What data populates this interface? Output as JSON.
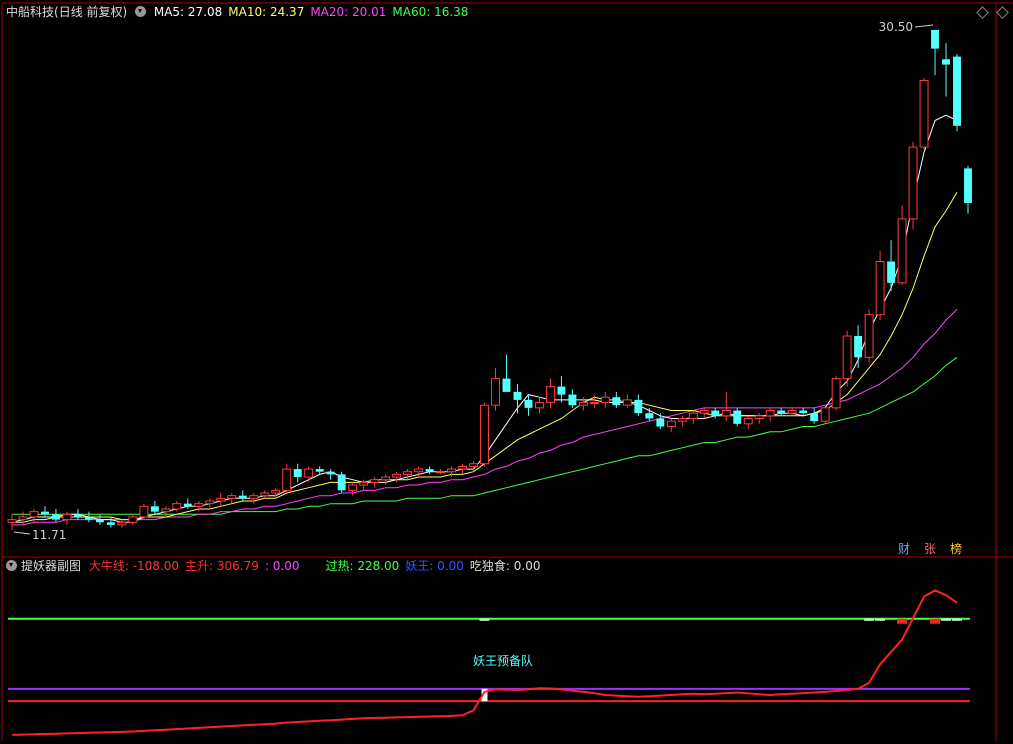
{
  "main_panel": {
    "stock_name": "中船科技",
    "period": "(日线 前复权)",
    "ma": [
      {
        "label": "MA5: 27.08",
        "color": "#ffffff"
      },
      {
        "label": "MA10: 24.37",
        "color": "#ffff66"
      },
      {
        "label": "MA20: 20.01",
        "color": "#ff44ff"
      },
      {
        "label": "MA60: 16.38",
        "color": "#44ff44"
      }
    ],
    "high_label": "30.50",
    "low_label": "11.71",
    "side_tags": [
      {
        "label": "财",
        "color": "#66aaff"
      },
      {
        "label": "张",
        "color": "#ff6666"
      },
      {
        "label": "榜",
        "color": "#ffcc33"
      }
    ]
  },
  "sub_panel": {
    "title": "提妖器副图",
    "items": [
      {
        "label": "大牛线: -108.00",
        "color": "#ff3333"
      },
      {
        "label": "主升: 306.79",
        "color": "#ff3333"
      },
      {
        "label": ": 0.00",
        "color": "#ff44ff"
      },
      {
        "label": "过热: 228.00",
        "color": "#44ff44"
      },
      {
        "label": "妖王: 0.00",
        "color": "#3355ff"
      },
      {
        "label": "吃独食: 0.00",
        "color": "#dddddd"
      }
    ],
    "annotation": "妖王预备队"
  },
  "colors": {
    "up": "#ff3b3b",
    "down": "#54ffff",
    "ma5": "#ffffff",
    "ma10": "#ffff66",
    "ma20": "#ff44ff",
    "ma60": "#44ff44",
    "frame": "#b00000"
  },
  "chart_data": {
    "type": "candlestick",
    "price_range": [
      11.71,
      30.5
    ],
    "candles": [
      {
        "o": 12.0,
        "h": 12.3,
        "l": 11.71,
        "c": 12.1
      },
      {
        "o": 12.1,
        "h": 12.4,
        "l": 11.9,
        "c": 12.2
      },
      {
        "o": 12.2,
        "h": 12.5,
        "l": 12.0,
        "c": 12.4
      },
      {
        "o": 12.4,
        "h": 12.6,
        "l": 12.2,
        "c": 12.3
      },
      {
        "o": 12.3,
        "h": 12.5,
        "l": 12.0,
        "c": 12.1
      },
      {
        "o": 12.1,
        "h": 12.4,
        "l": 11.9,
        "c": 12.3
      },
      {
        "o": 12.3,
        "h": 12.5,
        "l": 12.1,
        "c": 12.2
      },
      {
        "o": 12.2,
        "h": 12.4,
        "l": 12.0,
        "c": 12.1
      },
      {
        "o": 12.1,
        "h": 12.3,
        "l": 11.9,
        "c": 12.0
      },
      {
        "o": 12.0,
        "h": 12.2,
        "l": 11.8,
        "c": 11.9
      },
      {
        "o": 11.9,
        "h": 12.1,
        "l": 11.8,
        "c": 12.0
      },
      {
        "o": 12.0,
        "h": 12.3,
        "l": 11.9,
        "c": 12.2
      },
      {
        "o": 12.2,
        "h": 12.7,
        "l": 12.1,
        "c": 12.6
      },
      {
        "o": 12.6,
        "h": 12.8,
        "l": 12.3,
        "c": 12.4
      },
      {
        "o": 12.4,
        "h": 12.6,
        "l": 12.2,
        "c": 12.5
      },
      {
        "o": 12.5,
        "h": 12.8,
        "l": 12.4,
        "c": 12.7
      },
      {
        "o": 12.7,
        "h": 12.9,
        "l": 12.5,
        "c": 12.6
      },
      {
        "o": 12.6,
        "h": 12.8,
        "l": 12.4,
        "c": 12.7
      },
      {
        "o": 12.7,
        "h": 12.9,
        "l": 12.5,
        "c": 12.8
      },
      {
        "o": 12.8,
        "h": 13.1,
        "l": 12.6,
        "c": 12.9
      },
      {
        "o": 12.9,
        "h": 13.1,
        "l": 12.7,
        "c": 13.0
      },
      {
        "o": 13.0,
        "h": 13.2,
        "l": 12.8,
        "c": 12.9
      },
      {
        "o": 12.9,
        "h": 13.1,
        "l": 12.7,
        "c": 13.0
      },
      {
        "o": 13.0,
        "h": 13.2,
        "l": 12.9,
        "c": 13.1
      },
      {
        "o": 13.1,
        "h": 13.3,
        "l": 12.9,
        "c": 13.2
      },
      {
        "o": 13.2,
        "h": 14.2,
        "l": 13.1,
        "c": 14.0
      },
      {
        "o": 14.0,
        "h": 14.2,
        "l": 13.5,
        "c": 13.7
      },
      {
        "o": 13.7,
        "h": 14.1,
        "l": 13.5,
        "c": 14.0
      },
      {
        "o": 14.0,
        "h": 14.1,
        "l": 13.8,
        "c": 13.9
      },
      {
        "o": 13.9,
        "h": 14.0,
        "l": 13.6,
        "c": 13.8
      },
      {
        "o": 13.8,
        "h": 13.9,
        "l": 13.1,
        "c": 13.2
      },
      {
        "o": 13.2,
        "h": 13.5,
        "l": 13.0,
        "c": 13.4
      },
      {
        "o": 13.4,
        "h": 13.6,
        "l": 13.2,
        "c": 13.5
      },
      {
        "o": 13.5,
        "h": 13.7,
        "l": 13.3,
        "c": 13.6
      },
      {
        "o": 13.6,
        "h": 13.8,
        "l": 13.4,
        "c": 13.7
      },
      {
        "o": 13.7,
        "h": 13.9,
        "l": 13.5,
        "c": 13.8
      },
      {
        "o": 13.8,
        "h": 14.0,
        "l": 13.6,
        "c": 13.9
      },
      {
        "o": 13.9,
        "h": 14.1,
        "l": 13.7,
        "c": 14.0
      },
      {
        "o": 14.0,
        "h": 14.1,
        "l": 13.8,
        "c": 13.9
      },
      {
        "o": 13.9,
        "h": 14.0,
        "l": 13.8,
        "c": 13.9
      },
      {
        "o": 13.9,
        "h": 14.1,
        "l": 13.7,
        "c": 14.0
      },
      {
        "o": 14.0,
        "h": 14.2,
        "l": 13.8,
        "c": 14.1
      },
      {
        "o": 14.1,
        "h": 14.3,
        "l": 13.9,
        "c": 14.2
      },
      {
        "o": 14.2,
        "h": 16.5,
        "l": 14.1,
        "c": 16.4
      },
      {
        "o": 16.4,
        "h": 17.8,
        "l": 16.2,
        "c": 17.4
      },
      {
        "o": 17.4,
        "h": 18.3,
        "l": 16.9,
        "c": 16.9
      },
      {
        "o": 16.9,
        "h": 17.2,
        "l": 16.1,
        "c": 16.6
      },
      {
        "o": 16.6,
        "h": 16.8,
        "l": 16.0,
        "c": 16.3
      },
      {
        "o": 16.3,
        "h": 16.7,
        "l": 16.1,
        "c": 16.5
      },
      {
        "o": 16.5,
        "h": 17.4,
        "l": 16.3,
        "c": 17.1
      },
      {
        "o": 17.1,
        "h": 17.5,
        "l": 16.5,
        "c": 16.8
      },
      {
        "o": 16.8,
        "h": 17.0,
        "l": 16.3,
        "c": 16.4
      },
      {
        "o": 16.4,
        "h": 16.7,
        "l": 16.2,
        "c": 16.5
      },
      {
        "o": 16.5,
        "h": 16.8,
        "l": 16.3,
        "c": 16.5
      },
      {
        "o": 16.5,
        "h": 16.9,
        "l": 16.3,
        "c": 16.7
      },
      {
        "o": 16.7,
        "h": 16.9,
        "l": 16.3,
        "c": 16.4
      },
      {
        "o": 16.4,
        "h": 16.8,
        "l": 16.3,
        "c": 16.6
      },
      {
        "o": 16.6,
        "h": 16.8,
        "l": 16.0,
        "c": 16.1
      },
      {
        "o": 16.1,
        "h": 16.3,
        "l": 15.8,
        "c": 15.9
      },
      {
        "o": 15.9,
        "h": 16.1,
        "l": 15.5,
        "c": 15.6
      },
      {
        "o": 15.6,
        "h": 15.9,
        "l": 15.4,
        "c": 15.8
      },
      {
        "o": 15.8,
        "h": 16.0,
        "l": 15.6,
        "c": 15.9
      },
      {
        "o": 15.9,
        "h": 16.2,
        "l": 15.7,
        "c": 16.1
      },
      {
        "o": 16.1,
        "h": 16.3,
        "l": 15.9,
        "c": 16.2
      },
      {
        "o": 16.2,
        "h": 16.3,
        "l": 15.9,
        "c": 16.0
      },
      {
        "o": 16.0,
        "h": 16.9,
        "l": 15.8,
        "c": 16.2
      },
      {
        "o": 16.2,
        "h": 16.3,
        "l": 15.6,
        "c": 15.7
      },
      {
        "o": 15.7,
        "h": 16.0,
        "l": 15.5,
        "c": 15.9
      },
      {
        "o": 15.9,
        "h": 16.1,
        "l": 15.7,
        "c": 16.0
      },
      {
        "o": 16.0,
        "h": 16.3,
        "l": 15.8,
        "c": 16.2
      },
      {
        "o": 16.2,
        "h": 16.3,
        "l": 16.0,
        "c": 16.1
      },
      {
        "o": 16.1,
        "h": 16.3,
        "l": 16.0,
        "c": 16.2
      },
      {
        "o": 16.2,
        "h": 16.3,
        "l": 16.0,
        "c": 16.1
      },
      {
        "o": 16.1,
        "h": 16.3,
        "l": 15.7,
        "c": 15.8
      },
      {
        "o": 15.8,
        "h": 16.4,
        "l": 15.7,
        "c": 16.3
      },
      {
        "o": 16.3,
        "h": 17.5,
        "l": 16.2,
        "c": 17.4
      },
      {
        "o": 17.4,
        "h": 19.2,
        "l": 17.1,
        "c": 19.0
      },
      {
        "o": 19.0,
        "h": 19.4,
        "l": 17.8,
        "c": 18.2
      },
      {
        "o": 18.2,
        "h": 20.0,
        "l": 18.0,
        "c": 19.8
      },
      {
        "o": 19.8,
        "h": 22.2,
        "l": 19.6,
        "c": 21.8
      },
      {
        "o": 21.8,
        "h": 22.6,
        "l": 20.7,
        "c": 21.0
      },
      {
        "o": 21.0,
        "h": 23.9,
        "l": 20.9,
        "c": 23.4
      },
      {
        "o": 23.4,
        "h": 26.3,
        "l": 23.0,
        "c": 26.1
      },
      {
        "o": 26.1,
        "h": 28.7,
        "l": 26.0,
        "c": 28.6
      },
      {
        "o": 30.5,
        "h": 30.5,
        "l": 28.8,
        "c": 29.8
      },
      {
        "o": 29.4,
        "h": 30.0,
        "l": 28.0,
        "c": 29.2
      },
      {
        "o": 29.5,
        "h": 29.6,
        "l": 26.7,
        "c": 26.9
      },
      {
        "o": 25.3,
        "h": 25.4,
        "l": 23.6,
        "c": 24.0
      }
    ],
    "ma5": [
      12.0,
      12.1,
      12.2,
      12.2,
      12.2,
      12.3,
      12.3,
      12.2,
      12.1,
      12.1,
      12.0,
      12.0,
      12.2,
      12.3,
      12.4,
      12.5,
      12.6,
      12.6,
      12.7,
      12.8,
      12.9,
      12.9,
      12.9,
      13.0,
      13.0,
      13.2,
      13.4,
      13.6,
      13.8,
      13.9,
      13.7,
      13.6,
      13.5,
      13.5,
      13.5,
      13.6,
      13.7,
      13.8,
      13.9,
      13.9,
      13.9,
      14.0,
      14.0,
      14.5,
      15.1,
      15.7,
      16.3,
      16.8,
      16.7,
      16.6,
      16.6,
      16.6,
      16.6,
      16.6,
      16.5,
      16.5,
      16.5,
      16.4,
      16.2,
      16.0,
      15.9,
      15.9,
      15.9,
      15.9,
      16.0,
      16.1,
      16.0,
      16.0,
      16.0,
      16.0,
      16.1,
      16.1,
      16.0,
      16.1,
      16.3,
      16.9,
      17.3,
      18.1,
      19.2,
      20.0,
      20.8,
      22.0,
      24.1,
      25.9,
      27.1,
      27.3,
      27.1
    ],
    "ma10": [
      12.0,
      12.0,
      12.1,
      12.1,
      12.2,
      12.2,
      12.2,
      12.2,
      12.2,
      12.2,
      12.1,
      12.1,
      12.2,
      12.2,
      12.2,
      12.3,
      12.4,
      12.5,
      12.5,
      12.6,
      12.7,
      12.8,
      12.8,
      12.9,
      12.9,
      13.1,
      13.2,
      13.3,
      13.4,
      13.5,
      13.5,
      13.5,
      13.5,
      13.6,
      13.6,
      13.6,
      13.6,
      13.7,
      13.7,
      13.7,
      13.8,
      13.8,
      13.9,
      14.2,
      14.5,
      14.8,
      15.1,
      15.3,
      15.5,
      15.7,
      15.9,
      16.2,
      16.5,
      16.7,
      16.6,
      16.6,
      16.5,
      16.5,
      16.4,
      16.3,
      16.2,
      16.2,
      16.2,
      16.1,
      16.0,
      16.0,
      16.0,
      16.0,
      16.0,
      16.0,
      16.0,
      16.0,
      16.0,
      16.1,
      16.2,
      16.5,
      16.8,
      17.3,
      17.8,
      18.3,
      19.0,
      19.8,
      20.8,
      22.0,
      23.1,
      23.7,
      24.4
    ],
    "ma20": [
      11.9,
      11.9,
      12.0,
      12.0,
      12.0,
      12.1,
      12.1,
      12.1,
      12.1,
      12.1,
      12.1,
      12.1,
      12.1,
      12.1,
      12.2,
      12.2,
      12.2,
      12.3,
      12.3,
      12.4,
      12.4,
      12.5,
      12.5,
      12.6,
      12.6,
      12.7,
      12.8,
      12.9,
      13.0,
      13.0,
      13.1,
      13.1,
      13.2,
      13.2,
      13.3,
      13.3,
      13.4,
      13.4,
      13.5,
      13.5,
      13.6,
      13.6,
      13.7,
      13.8,
      14.0,
      14.1,
      14.3,
      14.4,
      14.6,
      14.7,
      14.9,
      15.0,
      15.2,
      15.3,
      15.4,
      15.5,
      15.6,
      15.7,
      15.8,
      15.9,
      16.0,
      16.1,
      16.2,
      16.3,
      16.3,
      16.3,
      16.3,
      16.3,
      16.3,
      16.3,
      16.3,
      16.3,
      16.3,
      16.3,
      16.4,
      16.5,
      16.6,
      16.8,
      17.0,
      17.2,
      17.5,
      17.8,
      18.2,
      18.7,
      19.1,
      19.6,
      20.0
    ],
    "ma60": [
      12.3,
      12.3,
      12.3,
      12.3,
      12.3,
      12.3,
      12.3,
      12.3,
      12.3,
      12.3,
      12.3,
      12.3,
      12.3,
      12.3,
      12.3,
      12.3,
      12.3,
      12.3,
      12.3,
      12.3,
      12.4,
      12.4,
      12.4,
      12.4,
      12.4,
      12.5,
      12.5,
      12.6,
      12.6,
      12.7,
      12.7,
      12.7,
      12.8,
      12.8,
      12.8,
      12.8,
      12.9,
      12.9,
      12.9,
      12.9,
      13.0,
      13.0,
      13.0,
      13.1,
      13.2,
      13.3,
      13.4,
      13.5,
      13.6,
      13.7,
      13.8,
      13.9,
      14.0,
      14.1,
      14.2,
      14.3,
      14.4,
      14.5,
      14.5,
      14.6,
      14.7,
      14.8,
      14.9,
      15.0,
      15.0,
      15.1,
      15.2,
      15.2,
      15.3,
      15.4,
      15.4,
      15.5,
      15.6,
      15.6,
      15.7,
      15.8,
      15.9,
      16.0,
      16.1,
      16.3,
      16.5,
      16.7,
      16.9,
      17.2,
      17.5,
      17.9,
      18.2
    ],
    "sub_indicator": {
      "range": [
        -160,
        380
      ],
      "levels": [
        {
          "value": 228,
          "color": "#44ff44"
        },
        {
          "value": 0,
          "color": "#9933ff"
        },
        {
          "value": -40,
          "color": "#ff2222"
        }
      ],
      "line": [
        -150,
        -149,
        -148,
        -147,
        -146,
        -145,
        -144,
        -143,
        -142,
        -141,
        -140,
        -139,
        -137,
        -135,
        -133,
        -131,
        -129,
        -127,
        -125,
        -123,
        -121,
        -119,
        -117,
        -115,
        -113,
        -110,
        -108,
        -106,
        -104,
        -102,
        -100,
        -98,
        -96,
        -95,
        -94,
        -93,
        -92,
        -91,
        -90,
        -89,
        -88,
        -86,
        -70,
        -10,
        -2,
        -3,
        -4,
        -2,
        2,
        1,
        -2,
        -6,
        -10,
        -14,
        -20,
        -22,
        -24,
        -26,
        -24,
        -22,
        -20,
        -18,
        -16,
        -18,
        -16,
        -14,
        -12,
        -15,
        -18,
        -20,
        -18,
        -16,
        -14,
        -12,
        -10,
        -7,
        -4,
        0,
        20,
        80,
        120,
        160,
        230,
        300,
        320,
        305,
        280
      ],
      "markers": [
        {
          "index": 43,
          "value": 228,
          "color": "#ffffff"
        },
        {
          "index": 78,
          "value": 228,
          "color": "#ffffff"
        },
        {
          "index": 79,
          "value": 228,
          "color": "#ffffff"
        },
        {
          "index": 81,
          "value": 228,
          "color": "#ff2222"
        },
        {
          "index": 84,
          "value": 228,
          "color": "#ff2222"
        },
        {
          "index": 85,
          "value": 228,
          "color": "#ffffff"
        },
        {
          "index": 86,
          "value": 228,
          "color": "#ffffff"
        }
      ],
      "bar": {
        "index": 43,
        "from": -40,
        "to": 0,
        "color": "#ffffff"
      }
    }
  }
}
